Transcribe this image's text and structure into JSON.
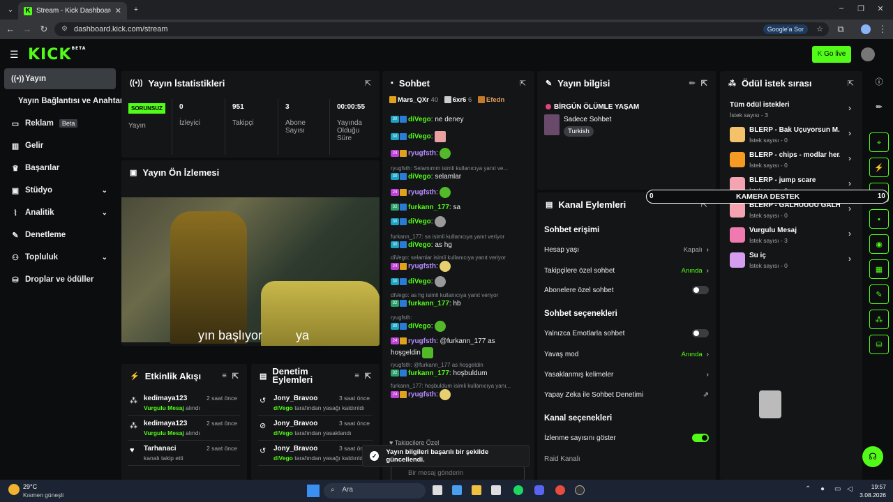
{
  "browser": {
    "tab_title": "Stream - Kick Dashboard",
    "url": "dashboard.kick.com/stream",
    "google_sor": "Google'a Sor"
  },
  "header": {
    "logo": "KICK",
    "logo_sup": "BETA",
    "go_live": "Go live"
  },
  "sidebar": {
    "items": [
      {
        "label": "Yayın"
      },
      {
        "label": "Yayın Bağlantısı ve Anahtarı"
      },
      {
        "label": "Reklam",
        "badge": "Beta"
      },
      {
        "label": "Gelir"
      },
      {
        "label": "Başarılar"
      },
      {
        "label": "Stüdyo"
      },
      {
        "label": "Analitik"
      },
      {
        "label": "Denetleme"
      },
      {
        "label": "Topluluk"
      },
      {
        "label": "Droplar ve ödüller"
      }
    ]
  },
  "stats": {
    "title": "Yayın İstatistikleri",
    "status": "SORUNSUZ",
    "status_label": "Yayın",
    "viewers": "0",
    "viewers_label": "İzleyici",
    "followers": "951",
    "followers_label": "Takipçi",
    "subs": "3",
    "subs_label": "Abone Sayısı",
    "uptime": "00:00:55",
    "uptime_label": "Yayında Olduğu Süre"
  },
  "preview": {
    "title": "Yayın Ön İzlemesi",
    "caption1": "yın başlıyor",
    "caption2": "ya"
  },
  "events": {
    "title": "Etkinlik Akışı",
    "rows": [
      {
        "name": "kedimaya123",
        "highlight": "Vurgulu Mesaj",
        "suffix": " alındı",
        "time": "2 saat önce"
      },
      {
        "name": "kedimaya123",
        "highlight": "Vurgulu Mesaj",
        "suffix": " alındı",
        "time": "2 saat önce"
      },
      {
        "name": "Tarhanaci",
        "highlight": "",
        "suffix": "kanalı takip etti",
        "time": "2 saat önce"
      }
    ]
  },
  "moderation": {
    "title": "Denetim Eylemleri",
    "rows": [
      {
        "name": "Jony_Bravoo",
        "highlight": "diVego",
        "suffix": " tarafından yasağı kaldırıldı",
        "time": "3 saat önce"
      },
      {
        "name": "Jony_Bravoo",
        "highlight": "diVego",
        "suffix": " tarafından yasaklandı",
        "time": "3 saat önce"
      },
      {
        "name": "Jony_Bravoo",
        "highlight": "diVego",
        "suffix": " tarafından yasağı kaldırıldı",
        "time": "3 saat önce"
      }
    ]
  },
  "chat": {
    "title": "Sohbet",
    "top": [
      {
        "name": "Mars_QXr",
        "count": "40"
      },
      {
        "name": "6xr6",
        "count": "6"
      },
      {
        "name": "Efedn",
        "count": ""
      }
    ],
    "lines": [
      {
        "reply": "",
        "user": "diVego",
        "text": ": ne deney"
      },
      {
        "reply": "",
        "user": "diVego",
        "text": ":"
      },
      {
        "reply": "",
        "user": "ryugfsth",
        "text": ":"
      },
      {
        "reply": "ryugfsth: Selamımm isimli kullanıcıya yanıt ve...",
        "user": "diVego",
        "text": ": selamlar"
      },
      {
        "reply": "",
        "user": "ryugfsth",
        "text": ":"
      },
      {
        "reply": "",
        "user": "furkann_177",
        "text": ": sa"
      },
      {
        "reply": "",
        "user": "diVego",
        "text": ":"
      },
      {
        "reply": "furkann_177: sa isimli kullanıcıya yanıt veriyor",
        "user": "diVego",
        "text": ": as hg"
      },
      {
        "reply": "diVego: selamlar isimli kullanıcıya yanıt veriyor",
        "user": "ryugfsth",
        "text": ":"
      },
      {
        "reply": "",
        "user": "diVego",
        "text": ":"
      },
      {
        "reply": "diVego: as hg isimli kullanıcıya yanıt veriyor",
        "user": "furkann_177",
        "text": ": hb"
      },
      {
        "reply": "ryugfsth:",
        "user": "diVego",
        "text": ":"
      },
      {
        "reply": "",
        "user": "ryugfsth",
        "text": ": @furkann_177 as"
      },
      {
        "reply": "",
        "user": "",
        "text": "hoşgeldin"
      },
      {
        "reply": "ryugfsth: @furkann_177 as hoşgeldin",
        "user": "furkann_177",
        "text": ": hoşbuldum"
      },
      {
        "reply": "furkann_177: hoşbuldum isimli kullanıcıya yanı...",
        "user": "ryugfsth",
        "text": ":"
      }
    ],
    "followers_only": "Takipçilere Özel",
    "input_placeholder": "Bir mesaj gönderin"
  },
  "stream_info": {
    "title": "Yayın bilgisi",
    "stream_title": "BİRGÜN ÖLÜMLE YAŞAM",
    "category": "Sadece Sohbet",
    "tag": "Turkish"
  },
  "channel_actions": {
    "title": "Kanal Eylemleri",
    "sec1": "Sohbet erişimi",
    "account_age": "Hesap yaşı",
    "account_age_val": "Kapalı",
    "followers_only": "Takipçilere özel sohbet",
    "followers_only_val": "Anında",
    "subs_only": "Abonelere özel sohbet",
    "sec2": "Sohbet seçenekleri",
    "emote_only": "Yalnızca Emotlarla sohbet",
    "slow_mode": "Yavaş mod",
    "slow_mode_val": "Anında",
    "banned_words": "Yasaklanmış kelimeler",
    "ai_mod": "Yapay Zeka ile Sohbet Denetimi",
    "sec3": "Kanal seçenekleri",
    "show_viewers": "İzlenme sayısını göster",
    "raid": "Raid Kanalı"
  },
  "rewards": {
    "title": "Ödül istek sırası",
    "all": "Tüm ödül istekleri",
    "all_count": "İstek sayısı - 3",
    "items": [
      {
        "title": "BLERP - Bak Uçuyorsun M...",
        "count": "İstek sayısı - 0",
        "color": "#f5c26b"
      },
      {
        "title": "BLERP - chips - modlar her...",
        "count": "İstek sayısı - 0",
        "color": "#f59b23"
      },
      {
        "title": "BLERP - jump scare",
        "count": "İstek sayısı - 0",
        "color": "#f4a3b0"
      },
      {
        "title": "BLERP - GALHÜÜÜÜ GALH...",
        "count": "İstek sayısı - 0",
        "color": "#f4a3b0"
      },
      {
        "title": "Vurgulu Mesaj",
        "count": "İstek sayısı - 3",
        "color": "#f07ab0"
      },
      {
        "title": "Su iç",
        "count": "İstek sayısı - 0",
        "color": "#d59cf0"
      }
    ]
  },
  "overlay": {
    "left": "0",
    "label": "KAMERA DESTEK",
    "right": "10"
  },
  "toast": "Yayın bilgileri başarılı bir şekilde güncellendi.",
  "taskbar": {
    "weather_temp": "29°C",
    "weather_text": "Kısmen güneşli",
    "search": "Ara",
    "time": "19:57",
    "date": "3.08.2026"
  },
  "colors": {
    "accent": "#53fc18",
    "bg": "#0b0d0e",
    "panel": "#131516"
  }
}
